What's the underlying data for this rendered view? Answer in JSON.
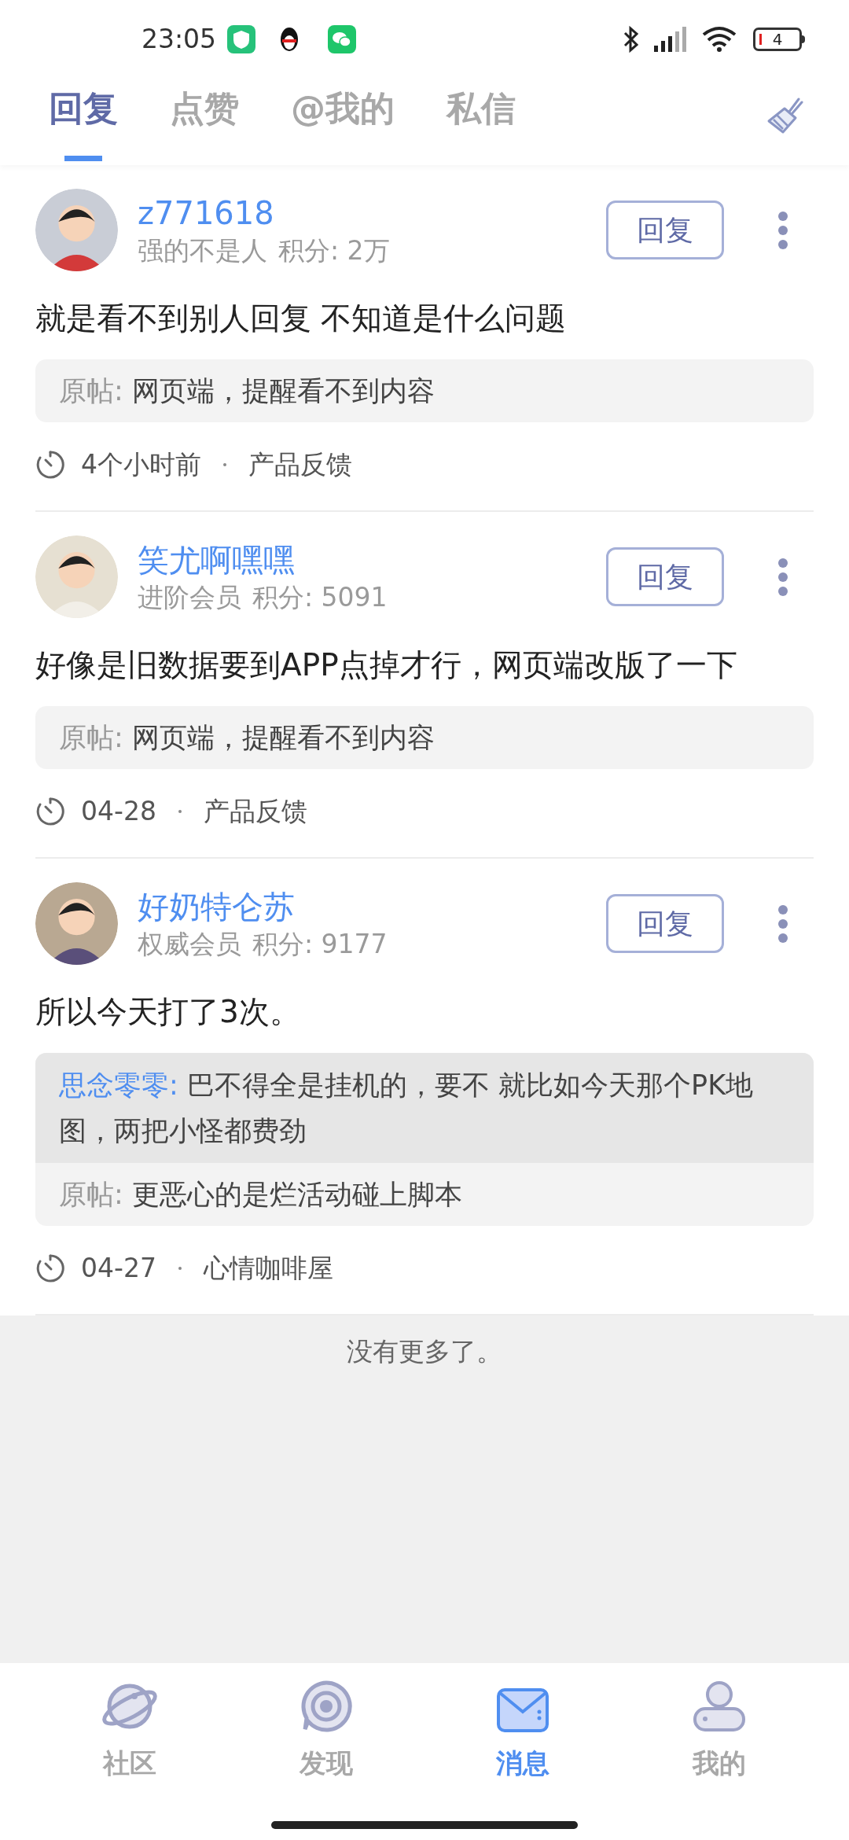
{
  "status_bar": {
    "time": "23:05",
    "battery": "4"
  },
  "tabs": [
    {
      "label": "回复",
      "selected": true
    },
    {
      "label": "点赞",
      "selected": false
    },
    {
      "label": "@我的",
      "selected": false
    },
    {
      "label": "私信",
      "selected": false
    }
  ],
  "posts": [
    {
      "username": "z771618",
      "rank": "强的不是人",
      "points": "积分: 2万",
      "reply_button": "回复",
      "content": "就是看不到别人回复 不知道是什么问题",
      "origin_label": "原帖:",
      "origin": "网页端，提醒看不到内容",
      "time": "4个小时前",
      "category": "产品反馈"
    },
    {
      "username": "笑尤啊嘿嘿",
      "rank": "进阶会员",
      "points": "积分: 5091",
      "reply_button": "回复",
      "content": "好像是旧数据要到APP点掉才行，网页端改版了一下",
      "origin_label": "原帖:",
      "origin": "网页端，提醒看不到内容",
      "time": "04-28",
      "category": "产品反馈"
    },
    {
      "username": "好奶特仑苏",
      "rank": "权威会员",
      "points": "积分: 9177",
      "reply_button": "回复",
      "content": "所以今天打了3次。",
      "quote_author": "思念零零:",
      "quote": "巴不得全是挂机的，要不 就比如今天那个PK地图，两把小怪都费劲",
      "origin_label": "原帖:",
      "origin": "更恶心的是烂活动碰上脚本",
      "time": "04-27",
      "category": "心情咖啡屋"
    }
  ],
  "end_text": "没有更多了。",
  "bottom_nav": [
    {
      "label": "社区",
      "kind": "planet",
      "selected": false
    },
    {
      "label": "发现",
      "kind": "discover",
      "selected": false
    },
    {
      "label": "消息",
      "kind": "mail",
      "selected": true
    },
    {
      "label": "我的",
      "kind": "profile",
      "selected": false
    }
  ]
}
